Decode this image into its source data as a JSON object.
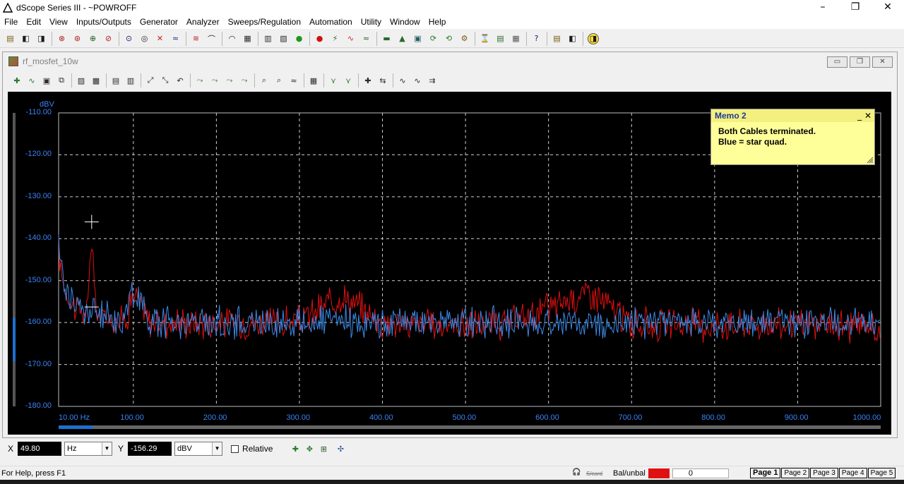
{
  "window": {
    "title": "dScope Series III - ~POWROFF",
    "icon": "app-triangle-icon"
  },
  "menu": [
    "File",
    "Edit",
    "View",
    "Inputs/Outputs",
    "Generator",
    "Analyzer",
    "Sweeps/Regulation",
    "Automation",
    "Utility",
    "Window",
    "Help"
  ],
  "toolbar": {
    "groups": [
      [
        "open-icon",
        "save-icon",
        "save-all-icon"
      ],
      [
        "output-off-icon",
        "output-icon",
        "generator-a-icon",
        "generator-b-icon"
      ],
      [
        "input-icon",
        "input-on-icon",
        "headphone-icon",
        "mute-icon"
      ],
      [
        "analyzer-a-icon",
        "analyzer-b-icon"
      ],
      [
        "scope-icon",
        "scope-b-icon"
      ],
      [
        "meter-1-icon",
        "meter-2-icon",
        "meter-3-icon"
      ],
      [
        "green-dot-icon",
        "red-record-icon",
        "sweep-icon",
        "sweep-stop-icon"
      ],
      [
        "trace-1-icon",
        "trace-2-icon",
        "trace-3-icon",
        "trace-4-icon",
        "trace-5-icon",
        "graph-icon"
      ],
      [
        "run-icon",
        "run-fast-icon",
        "macro-icon"
      ],
      [
        "filter-icon"
      ],
      [
        "report-icon",
        "print-icon"
      ],
      [
        "help-icon"
      ]
    ]
  },
  "child_window": {
    "title": "rf_mosfet_10w",
    "controls": [
      "minimize",
      "restore",
      "close"
    ]
  },
  "graph_toolbar": [
    "add-trace-icon",
    "trace-icon",
    "save-trace-icon",
    "copy-icon",
    "graph-view-icon",
    "graph-edit-icon",
    "table-icon",
    "table-b-icon",
    "zoom-fit-icon",
    "zoom-x-icon",
    "zoom-back-icon",
    "trace-a-icon",
    "trace-b-icon",
    "trace-c-icon",
    "trace-d-icon",
    "marker-a-icon",
    "marker-b-icon",
    "marker-c-icon",
    "properties-icon",
    "cursor-a-icon",
    "cursor-b-icon",
    "add-cursor-icon",
    "cursor-link-icon",
    "wave-a-icon",
    "wave-b-icon",
    "wave-c-icon"
  ],
  "memo": {
    "title": "Memo 2",
    "lines": [
      "Both Cables terminated.",
      "Blue = star quad."
    ]
  },
  "chart_data": {
    "type": "line",
    "ylabel": "dBV",
    "ylim": [
      -180,
      -110
    ],
    "xlim": [
      10,
      1000
    ],
    "yticks": [
      "-110.00",
      "-120.00",
      "-130.00",
      "-140.00",
      "-150.00",
      "-160.00",
      "-170.00",
      "-180.00"
    ],
    "xticks": [
      "10.00 Hz",
      "100.00",
      "200.00",
      "300.00",
      "400.00",
      "500.00",
      "600.00",
      "700.00",
      "800.00",
      "900.00",
      "1000.00"
    ],
    "xtick_values": [
      10,
      100,
      200,
      300,
      400,
      500,
      600,
      700,
      800,
      900,
      1000
    ],
    "grid": true,
    "background": "#000000",
    "series": [
      {
        "color": "#e01010",
        "noise_floor": -160.5,
        "points": [
          [
            10,
            -143
          ],
          [
            15,
            -150
          ],
          [
            20,
            -153
          ],
          [
            25,
            -155
          ],
          [
            30,
            -156
          ],
          [
            35,
            -157
          ],
          [
            40,
            -157.5
          ],
          [
            45,
            -158
          ],
          [
            49.8,
            -138
          ],
          [
            55,
            -158
          ],
          [
            60,
            -158.5
          ],
          [
            70,
            -159
          ],
          [
            80,
            -159
          ],
          [
            90,
            -159.5
          ],
          [
            100,
            -153
          ],
          [
            120,
            -160
          ],
          [
            150,
            -160
          ],
          [
            200,
            -160
          ],
          [
            250,
            -160
          ],
          [
            300,
            -160
          ],
          [
            350,
            -153.5
          ],
          [
            400,
            -160
          ],
          [
            450,
            -160.5
          ],
          [
            500,
            -160.5
          ],
          [
            550,
            -160.5
          ],
          [
            650,
            -152.5
          ],
          [
            700,
            -160.5
          ],
          [
            800,
            -160.5
          ],
          [
            900,
            -160.5
          ],
          [
            1000,
            -161
          ]
        ]
      },
      {
        "color": "#3a8ae8",
        "noise_floor": -160,
        "points": [
          [
            10,
            -141
          ],
          [
            15,
            -149
          ],
          [
            20,
            -152
          ],
          [
            25,
            -154
          ],
          [
            30,
            -155.5
          ],
          [
            35,
            -156.5
          ],
          [
            40,
            -157
          ],
          [
            50,
            -157.5
          ],
          [
            60,
            -158
          ],
          [
            70,
            -158.5
          ],
          [
            80,
            -159
          ],
          [
            90,
            -159
          ],
          [
            100,
            -152
          ],
          [
            120,
            -159.5
          ],
          [
            200,
            -160
          ],
          [
            300,
            -160
          ],
          [
            400,
            -160
          ],
          [
            500,
            -160
          ],
          [
            600,
            -160
          ],
          [
            700,
            -160
          ],
          [
            800,
            -160
          ],
          [
            900,
            -160
          ],
          [
            1000,
            -160.5
          ]
        ]
      }
    ],
    "cursor": {
      "x": 49.8,
      "y": -156.29,
      "marker_y": -136
    }
  },
  "readout": {
    "x_label": "X",
    "x_value": "49.80",
    "x_unit": "Hz",
    "y_label": "Y",
    "y_value": "-156.29",
    "y_unit": "dBV",
    "relative_label": "Relative"
  },
  "status": {
    "help": "For Help, press F1",
    "scard": "S/card",
    "balunbal": "Bal/unbal",
    "level": "0",
    "pages": [
      "Page 1",
      "Page 2",
      "Page 3",
      "Page 4",
      "Page 5"
    ],
    "active_page": "Page 1"
  }
}
